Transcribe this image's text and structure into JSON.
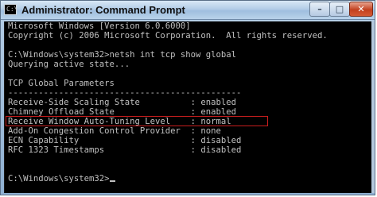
{
  "window": {
    "title": "Administrator: Command Prompt",
    "icon": "cmd-icon",
    "controls": [
      "minimize-icon",
      "maximize-icon",
      "close-icon"
    ],
    "accent_color": "#9fbfdf",
    "console_background": "#000000",
    "console_text_color": "#c0c0c0",
    "highlight_color": "#c81e1e"
  },
  "console": {
    "lines": [
      "Microsoft Windows [Version 6.0.6000]",
      "Copyright (c) 2006 Microsoft Corporation.  All rights reserved.",
      "",
      "C:\\Windows\\system32>netsh int tcp show global",
      "Querying active state...",
      "",
      "TCP Global Parameters",
      "----------------------------------------------",
      "Receive-Side Scaling State          : enabled",
      "Chimney Offload State               : enabled",
      "Receive Window Auto-Tuning Level    : normal",
      "Add-On Congestion Control Provider  : none",
      "ECN Capability                      : disabled",
      "RFC 1323 Timestamps                 : disabled",
      "",
      "",
      "C:\\Windows\\system32>"
    ],
    "highlighted_line_index": 10
  }
}
